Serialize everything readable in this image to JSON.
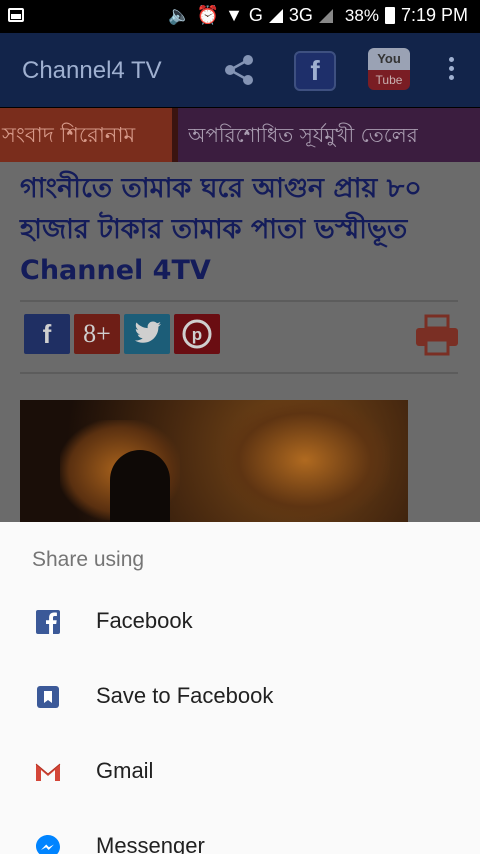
{
  "status_bar": {
    "network_g": "G",
    "network_3g": "3G",
    "battery": "38%",
    "time": "7:19 PM"
  },
  "app_bar": {
    "title": "Channel4 TV",
    "facebook_glyph": "f",
    "youtube_top": "You",
    "youtube_bottom": "Tube"
  },
  "ticker": {
    "label": "সংবাদ শিরোনাম",
    "text": "অপরিশোধিত সূর্যমুখী তেলের"
  },
  "article": {
    "headline": "গাংনীতে তামাক ঘরে আগুন প্রায় ৮০ হাজার টাকার তামাক পাতা ভস্মীভূত Channel 4TV",
    "social": [
      "f",
      "8+",
      "t",
      "p"
    ]
  },
  "share_sheet": {
    "heading": "Share using",
    "items": [
      {
        "label": "Facebook",
        "icon": "facebook-icon"
      },
      {
        "label": "Save to Facebook",
        "icon": "bookmark-icon"
      },
      {
        "label": "Gmail",
        "icon": "gmail-icon"
      },
      {
        "label": "Messenger",
        "icon": "messenger-icon"
      }
    ]
  },
  "colors": {
    "app_bar": "#12244a",
    "dim_overlay": "#6b6b6b",
    "sheet_bg": "#fafafa",
    "facebook_blue": "#3b5998",
    "gmail_red": "#d44638",
    "messenger_blue": "#0084ff"
  }
}
